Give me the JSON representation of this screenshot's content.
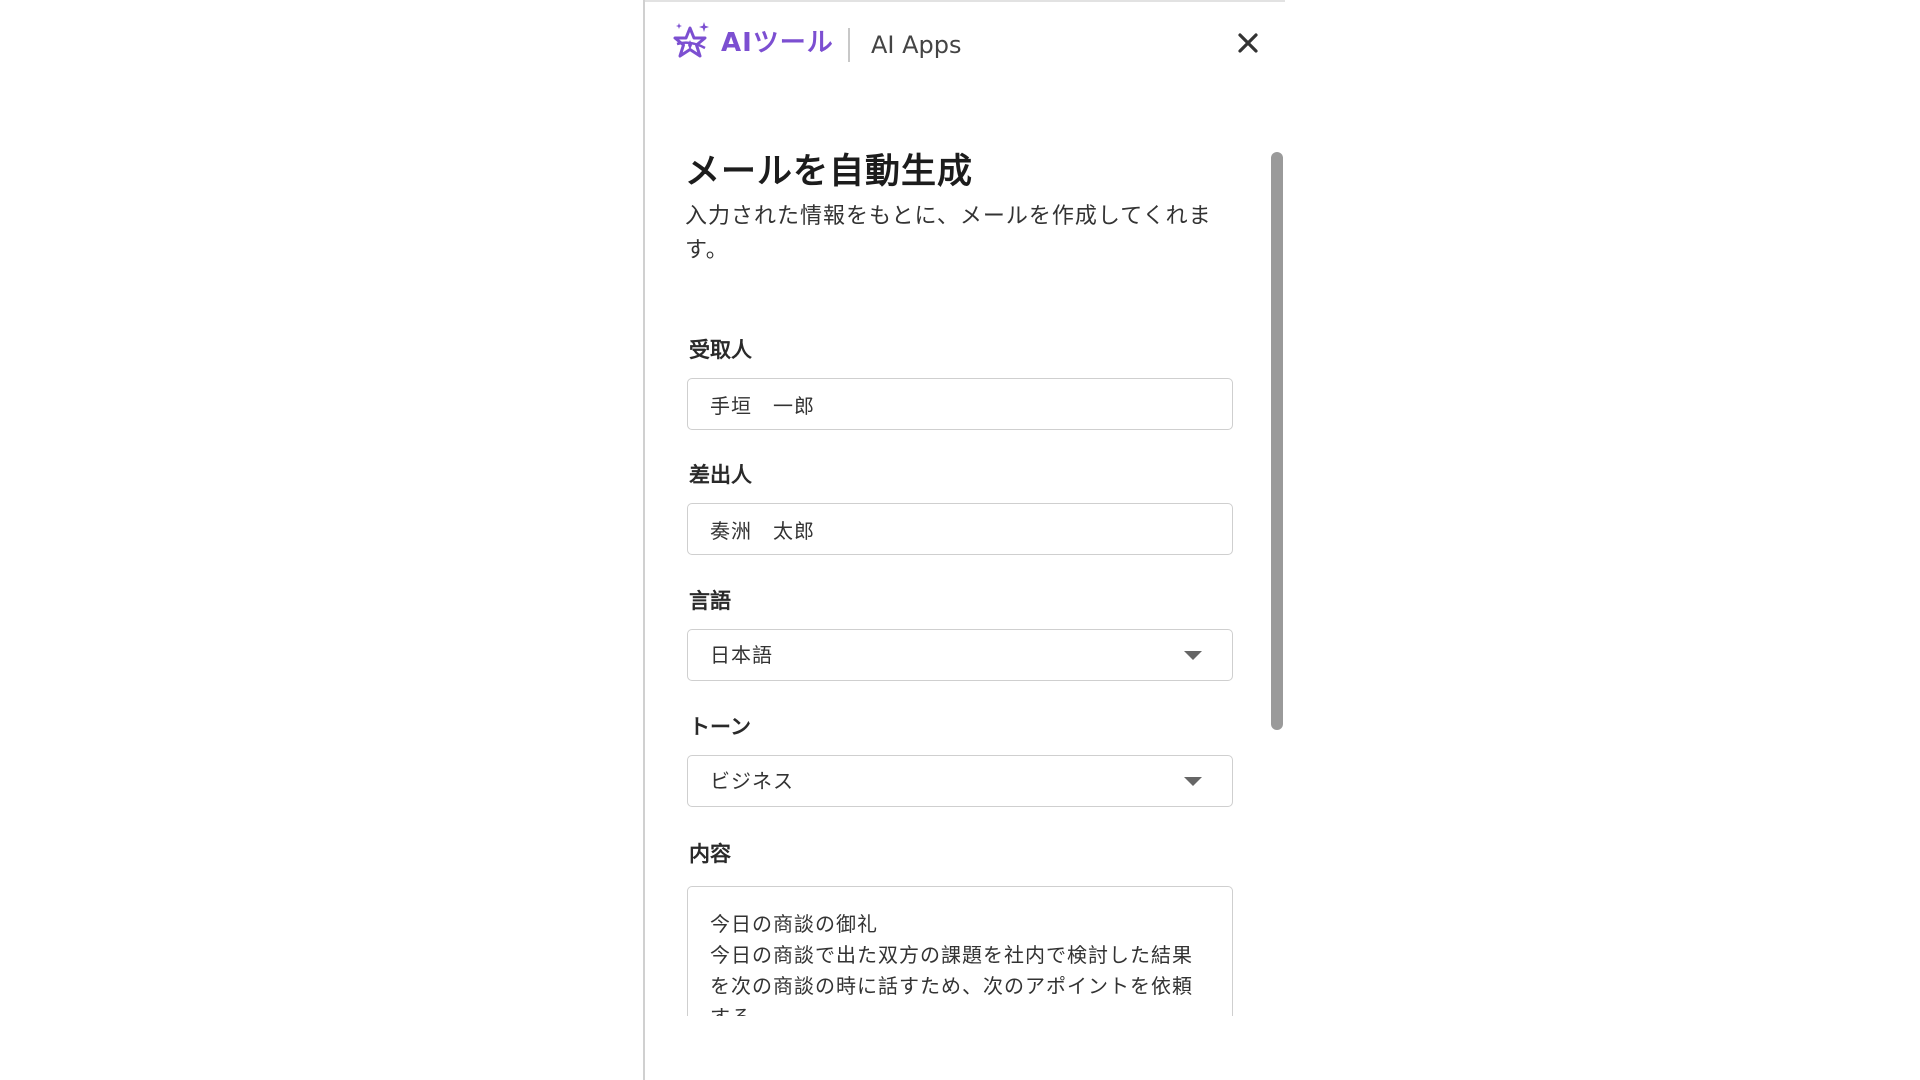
{
  "header": {
    "brand": "AIツール",
    "apps_label": "AI Apps"
  },
  "page": {
    "title": "メールを自動生成",
    "description": "入力された情報をもとに、メールを作成してくれます。"
  },
  "form": {
    "recipient": {
      "label": "受取人",
      "value": "手垣　一郎"
    },
    "sender": {
      "label": "差出人",
      "value": "奏洲　太郎"
    },
    "language": {
      "label": "言語",
      "value": "日本語"
    },
    "tone": {
      "label": "トーン",
      "value": "ビジネス"
    },
    "content": {
      "label": "内容",
      "value": "今日の商談の御礼\n今日の商談で出た双方の課題を社内で検討した結果を次の商談の時に話すため、次のアポイントを依頼する"
    }
  },
  "icons": {
    "logo": "sparkle-star-icon",
    "close": "close-icon",
    "dropdown": "chevron-down-icon"
  },
  "colors": {
    "brand": "#7c4fd1"
  }
}
